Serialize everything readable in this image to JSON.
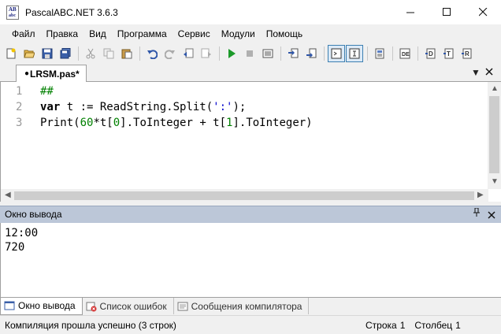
{
  "window": {
    "title": "PascalABC.NET 3.6.3",
    "icon_letters": [
      "AB",
      "abc"
    ],
    "controls": [
      "minimize",
      "maximize",
      "close"
    ]
  },
  "menu": [
    "Файл",
    "Правка",
    "Вид",
    "Программа",
    "Сервис",
    "Модули",
    "Помощь"
  ],
  "toolbar": {
    "icons": [
      "new-file-icon",
      "open-icon",
      "save-icon",
      "save-all-icon",
      "cut-icon",
      "copy-icon",
      "paste-icon",
      "undo-icon",
      "redo-icon",
      "navigate-back-icon",
      "navigate-forward-icon",
      "run-icon",
      "stop-icon",
      "compile-icon",
      "step-into-icon",
      "step-over-icon",
      "output-window-icon",
      "input-window-icon",
      "form-designer-icon",
      "debug-icon",
      "breakpoint-icon",
      "watch-icon",
      "restart-icon"
    ],
    "active": [
      "output-window-icon",
      "input-window-icon"
    ]
  },
  "editor": {
    "tab_label": "LRSM.pas*",
    "modified_marker": "●",
    "line_numbers": [
      "1",
      "2",
      "3"
    ],
    "lines": [
      [
        {
          "t": "##",
          "c": "cm"
        }
      ],
      [
        {
          "t": "var",
          "c": "kw"
        },
        {
          "t": " t := ReadString.Split(",
          "c": ""
        },
        {
          "t": "':'",
          "c": "str"
        },
        {
          "t": ");",
          "c": ""
        }
      ],
      [
        {
          "t": "Print(",
          "c": ""
        },
        {
          "t": "60",
          "c": "num"
        },
        {
          "t": "*t[",
          "c": ""
        },
        {
          "t": "0",
          "c": "num"
        },
        {
          "t": "].ToInteger + t[",
          "c": ""
        },
        {
          "t": "1",
          "c": "num"
        },
        {
          "t": "].ToInteger)",
          "c": ""
        }
      ]
    ]
  },
  "output_panel": {
    "title": "Окно вывода",
    "lines": [
      "12:00",
      "720"
    ]
  },
  "bottom_tabs": [
    "Окно вывода",
    "Список ошибок",
    "Сообщения компилятора"
  ],
  "status": {
    "message": "Компиляция прошла успешно (3 строк)",
    "row_label": "Строка",
    "row_value": "1",
    "col_label": "Столбец",
    "col_value": "1"
  }
}
